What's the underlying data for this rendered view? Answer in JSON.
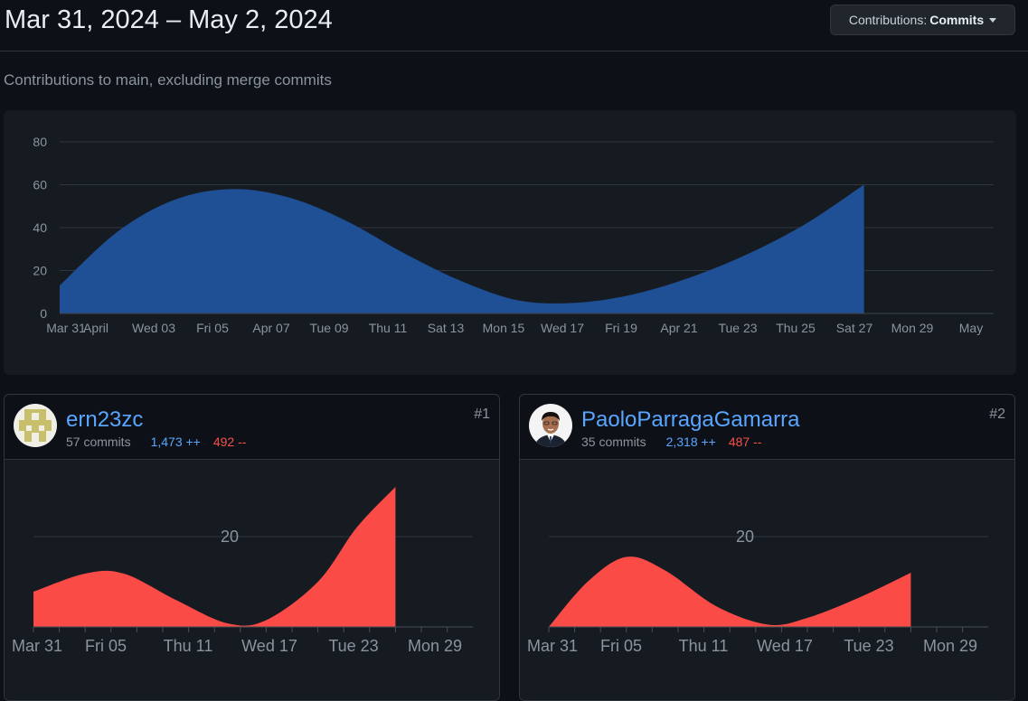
{
  "header": {
    "date_range": "Mar 31, 2024 – May 2, 2024",
    "contrib_button": {
      "prefix": "Contributions:",
      "value": "Commits"
    }
  },
  "subtitle": "Contributions to main, excluding merge commits",
  "colors": {
    "main_area": "#1f4f94",
    "contributor_area": "#fa4b47",
    "link": "#58a6ff",
    "additions": "#58a6ff",
    "deletions": "#f85149"
  },
  "chart_data": [
    {
      "type": "area",
      "title": "",
      "ylim": [
        0,
        80
      ],
      "yticks": [
        0,
        20,
        40,
        60,
        80
      ],
      "xticks": [
        "Mar 31",
        "April",
        "Wed 03",
        "Fri 05",
        "Apr 07",
        "Tue 09",
        "Thu 11",
        "Sat 13",
        "Mon 15",
        "Wed 17",
        "Fri 19",
        "Apr 21",
        "Tue 23",
        "Thu 25",
        "Sat 27",
        "Mon 29",
        "May"
      ],
      "x": [
        "Mar 31",
        "Apr 02",
        "Apr 04",
        "Apr 06",
        "Apr 08",
        "Apr 10",
        "Apr 12",
        "Apr 14",
        "Apr 16",
        "Apr 18",
        "Apr 20",
        "Apr 22",
        "Apr 24",
        "Apr 26",
        "Apr 28"
      ],
      "values": [
        13,
        38,
        53,
        58,
        54,
        43,
        28,
        15,
        6,
        5,
        9,
        17,
        28,
        42,
        60
      ],
      "grid": true
    },
    {
      "type": "area",
      "ylim": [
        0,
        28
      ],
      "yticks": [
        20
      ],
      "xticks": [
        "Mar 31",
        "Fri 05",
        "Thu 11",
        "Wed 17",
        "Tue 23",
        "Mon 29"
      ],
      "x": [
        "Mar 31",
        "Apr 04",
        "Apr 07",
        "Apr 11",
        "Apr 15",
        "Apr 18",
        "Apr 22",
        "Apr 25",
        "Apr 28"
      ],
      "values": [
        7.8,
        11.8,
        11.8,
        6.0,
        0.8,
        1.5,
        10.0,
        22.0,
        31.0
      ],
      "grid": true
    },
    {
      "type": "area",
      "ylim": [
        0,
        28
      ],
      "yticks": [
        20
      ],
      "xticks": [
        "Mar 31",
        "Fri 05",
        "Thu 11",
        "Wed 17",
        "Tue 23",
        "Mon 29"
      ],
      "x": [
        "Mar 31",
        "Apr 03",
        "Apr 06",
        "Apr 09",
        "Apr 13",
        "Apr 17",
        "Apr 20",
        "Apr 24",
        "Apr 28"
      ],
      "values": [
        0,
        10,
        15.5,
        12.5,
        4.5,
        0.5,
        2.0,
        6.5,
        12.0
      ],
      "grid": true
    }
  ],
  "contributors": [
    {
      "rank": "#1",
      "username": "ern23zc",
      "commits": "57 commits",
      "additions": "1,473 ++",
      "deletions": "492 --"
    },
    {
      "rank": "#2",
      "username": "PaoloParragaGamarra",
      "commits": "35 commits",
      "additions": "2,318 ++",
      "deletions": "487 --"
    }
  ]
}
